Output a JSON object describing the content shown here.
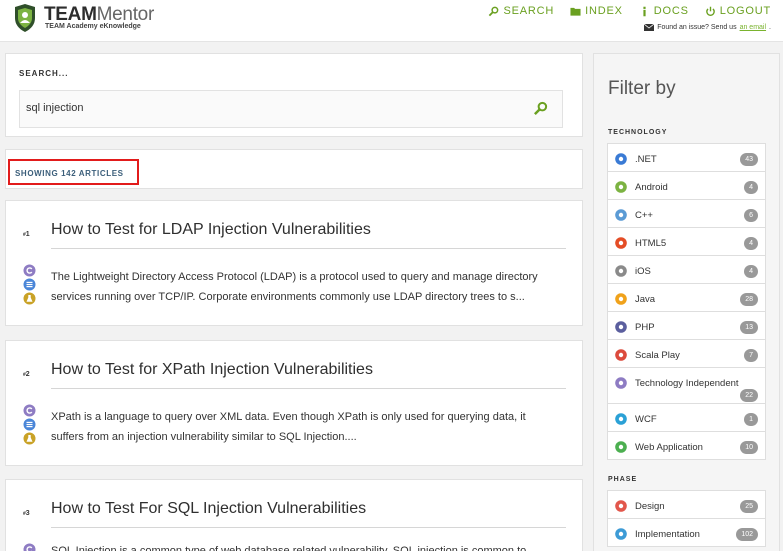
{
  "header": {
    "brand_strong": "TEAM",
    "brand_light": "Mentor",
    "tagline": "TEAM Academy eKnowledge",
    "nav": [
      {
        "label": "SEARCH",
        "icon": "search-icon"
      },
      {
        "label": "INDEX",
        "icon": "folder-icon"
      },
      {
        "label": "DOCS",
        "icon": "info-icon"
      },
      {
        "label": "LOGOUT",
        "icon": "power-icon"
      }
    ],
    "issue_text": "Found an issue? Send us",
    "issue_link": "an email",
    "issue_end": "."
  },
  "search": {
    "label": "SEARCH...",
    "value": "sql injection"
  },
  "results": {
    "showing": "SHOWING 142 ARTICLES"
  },
  "articles": [
    {
      "number": "1",
      "title": "How to Test for LDAP Injection Vulnerabilities",
      "description": "The Lightweight Directory Access Protocol (LDAP) is a protocol used to query and manage directory services running over TCP/IP. Corporate environments commonly use LDAP directory trees to s..."
    },
    {
      "number": "2",
      "title": "How to Test for XPath Injection Vulnerabilities",
      "description": "XPath is a language to query over XML data. Even though XPath is only used for querying data, it suffers from an injection vulnerability similar to SQL Injection...."
    },
    {
      "number": "3",
      "title": "How to Test For SQL Injection Vulnerabilities",
      "description": "SQL Injection is a common type of web database related vulnerability. SQL injection is common to"
    }
  ],
  "filter": {
    "title": "Filter by",
    "technology_label": "TECHNOLOGY",
    "technology": [
      {
        "label": ".NET",
        "count": "43",
        "color": "#3a7bd5",
        "icon": "dotnet-icon"
      },
      {
        "label": "Android",
        "count": "4",
        "color": "#7cb342",
        "icon": "android-icon"
      },
      {
        "label": "C++",
        "count": "6",
        "color": "#5b9bd5",
        "icon": "cpp-icon"
      },
      {
        "label": "HTML5",
        "count": "4",
        "color": "#e44d26",
        "icon": "html5-icon"
      },
      {
        "label": "iOS",
        "count": "4",
        "color": "#8a8a8a",
        "icon": "apple-icon"
      },
      {
        "label": "Java",
        "count": "28",
        "color": "#f0a21b",
        "icon": "java-icon"
      },
      {
        "label": "PHP",
        "count": "13",
        "color": "#5b5f9e",
        "icon": "php-icon"
      },
      {
        "label": "Scala Play",
        "count": "7",
        "color": "#dc4b3d",
        "icon": "scala-icon"
      },
      {
        "label": "Technology Independent",
        "count": "22",
        "color": "#8e7cc3",
        "icon": "technology-independent-icon"
      },
      {
        "label": "WCF",
        "count": "1",
        "color": "#2ba1d6",
        "icon": "wcf-icon"
      },
      {
        "label": "Web Application",
        "count": "10",
        "color": "#4caf50",
        "icon": "web-application-icon"
      }
    ],
    "phase_label": "PHASE",
    "phase": [
      {
        "label": "Design",
        "count": "25",
        "color": "#e2574c",
        "icon": "design-icon"
      },
      {
        "label": "Implementation",
        "count": "102",
        "color": "#3d9bd6",
        "icon": "implementation-icon"
      }
    ]
  }
}
